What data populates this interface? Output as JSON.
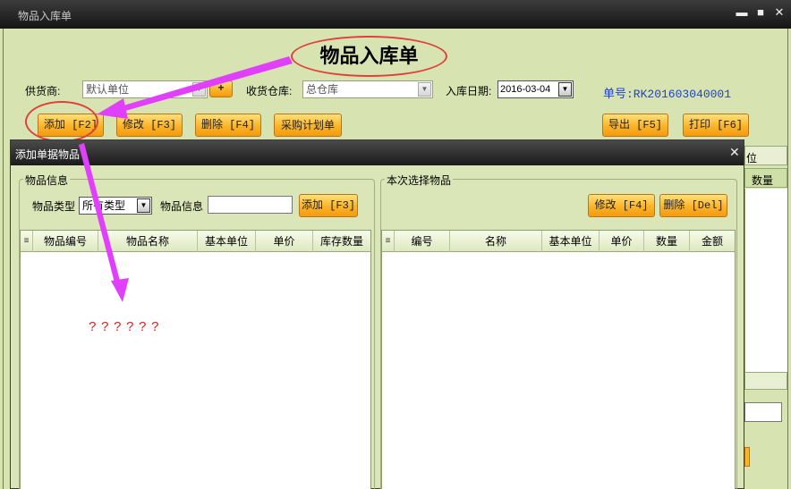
{
  "window": {
    "title": "物品入库单",
    "minimize": "▬",
    "maximize": "■",
    "close": "✕"
  },
  "form": {
    "heading": "物品入库单",
    "supplier": {
      "label": "供货商:",
      "value": "默认单位",
      "add": "+"
    },
    "warehouse": {
      "label": "收货仓库:",
      "value": "总仓库"
    },
    "date": {
      "label": "入库日期:",
      "value": "2016-03-04"
    },
    "doc_number": "单号:RK201603040001"
  },
  "toolbar": {
    "add": "添加 [F2]",
    "edit": "修改 [F3]",
    "delete": "删除 [F4]",
    "purchase_plan": "采购计划单",
    "export": "导出 [F5]",
    "print": "打印 [F6]"
  },
  "background_grid": {
    "col_partial": "位",
    "col_qty": "数量"
  },
  "dialog": {
    "title": "添加单据物品",
    "close": "✕",
    "left_group": {
      "label": "物品信息",
      "type_label": "物品类型",
      "type_value": "所有类型",
      "info_label": "物品信息",
      "info_value": "",
      "add_button": "添加 [F3]",
      "columns": [
        "物品编号",
        "物品名称",
        "基本单位",
        "单价",
        "库存数量"
      ],
      "annotation": "??????"
    },
    "right_group": {
      "label": "本次选择物品",
      "edit_button": "修改 [F4]",
      "delete_button": "删除 [Del]",
      "columns": [
        "编号",
        "名称",
        "基本单位",
        "单价",
        "数量",
        "金额"
      ]
    }
  },
  "colors": {
    "annotation": "#e040fb",
    "oval": "#e0403c",
    "button": "#fbb328",
    "doc_number": "#1f3fcf",
    "background": "#d7e4b2"
  },
  "icons": {
    "row_marker": "grid-mark-icon",
    "dropdown": "chevron-down-icon"
  }
}
